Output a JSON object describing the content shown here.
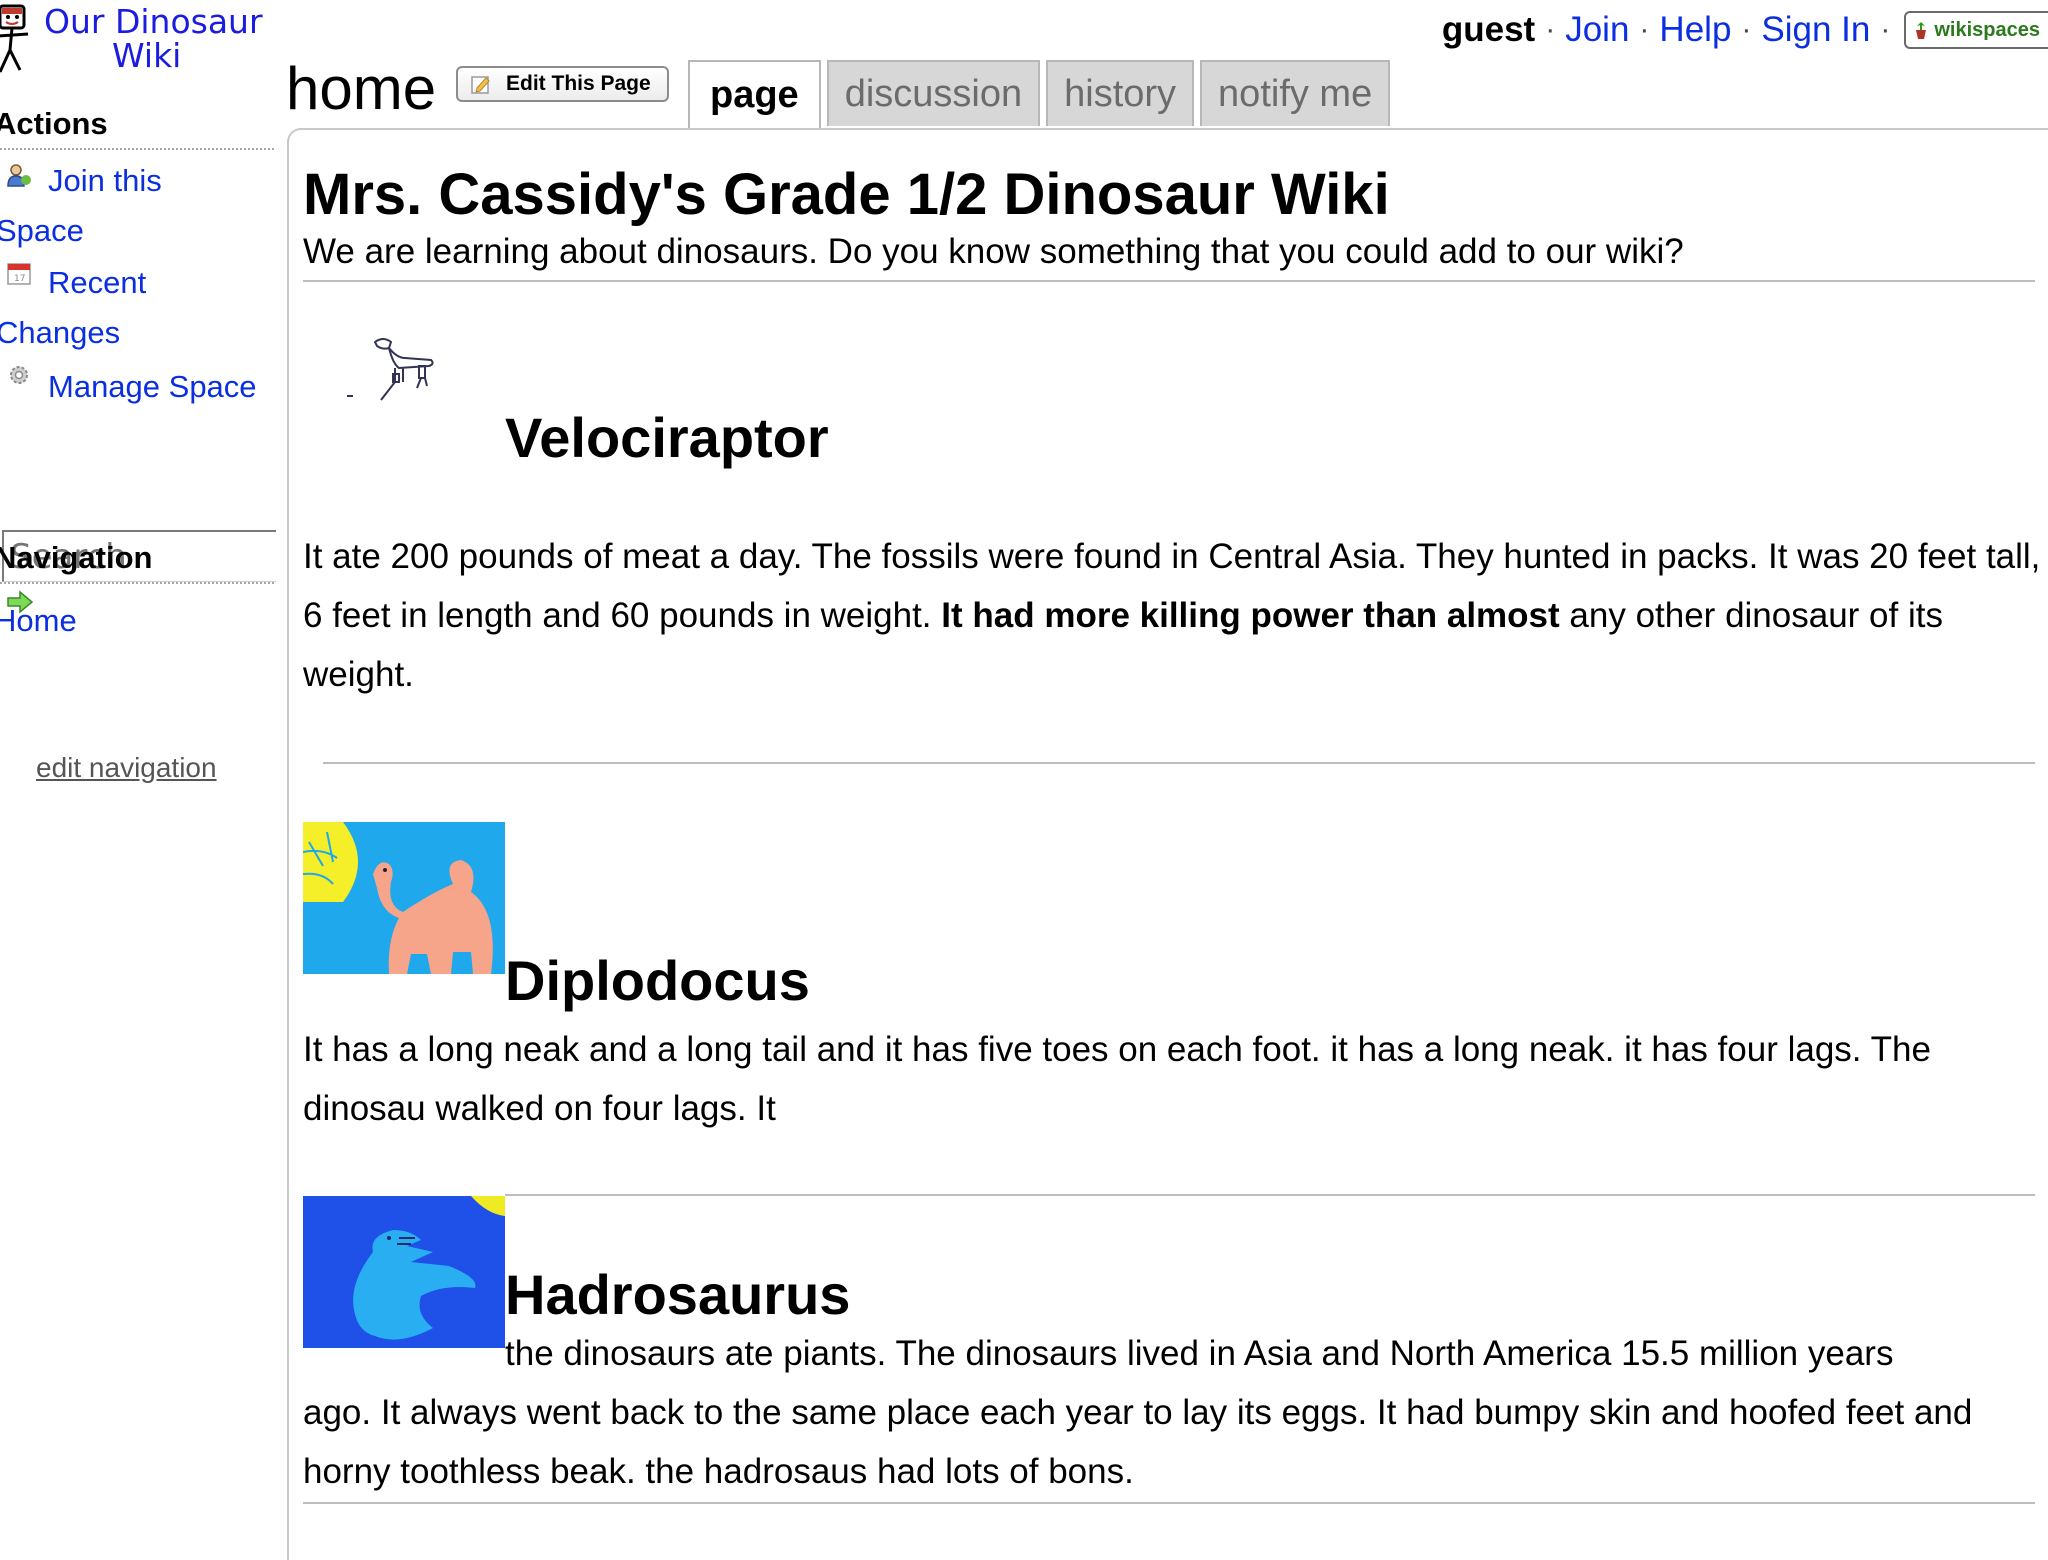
{
  "logo": {
    "line1": "Our Dinosaur",
    "line2": "Wiki"
  },
  "userbar": {
    "guest": "guest",
    "join": "Join",
    "help": "Help",
    "sign_in": "Sign In",
    "separator": "·",
    "badge": "wikispaces"
  },
  "page": {
    "name": "home",
    "edit_label": "Edit This Page"
  },
  "tabs": [
    {
      "label": "page",
      "active": true
    },
    {
      "label": "discussion",
      "active": false
    },
    {
      "label": "history",
      "active": false
    },
    {
      "label": "notify me",
      "active": false
    }
  ],
  "sidebar": {
    "actions_heading": "Actions",
    "actions": [
      {
        "line1": "Join this",
        "line2": "Space",
        "icon": "user-icon"
      },
      {
        "line1": "Recent",
        "line2": "Changes",
        "icon": "calendar-icon"
      },
      {
        "line1": "Manage Space",
        "icon": "gear-icon"
      }
    ],
    "search_placeholder": "Search",
    "navigation_heading": "Navigation",
    "nav_items": [
      "Home"
    ],
    "edit_navigation": "edit navigation"
  },
  "main": {
    "title": "Mrs. Cassidy's Grade 1/2 Dinosaur Wiki",
    "subtitle": "We are learning about dinosaurs. Do you know something that you could add to our wiki?",
    "dinosaurs": [
      {
        "name": "Velociraptor",
        "text_plain": "It ate 200 pounds of meat a day. The fossils were found in Central Asia. They hunted in packs. It was 20 feet tall, 6 feet in length and 60 pounds in weight. ",
        "text_bold": "It had more killing power than almost",
        "text_end": " any other dinosaur of its weight."
      },
      {
        "name": "Diplodocus",
        "text": "It has a long neak and a long tail and it has five toes on each foot. it has a long neak. it has four lags. The dinosau walked on four lags. It"
      },
      {
        "name": "Hadrosaurus",
        "text_line1": "the dinosaurs ate piants. The dinosaurs lived in Asia and North America 15.5 million years",
        "text_rest": "ago. It always went back to the same place each year to lay its eggs. It had bumpy skin and hoofed feet and horny toothless beak. the hadrosaus had lots of bons."
      }
    ]
  },
  "colors": {
    "link": "#0a2ee0",
    "tab_inactive_bg": "#d7d7d7",
    "tab_inactive_text": "#6b6b6b",
    "logo_text": "#1c1ce0"
  }
}
